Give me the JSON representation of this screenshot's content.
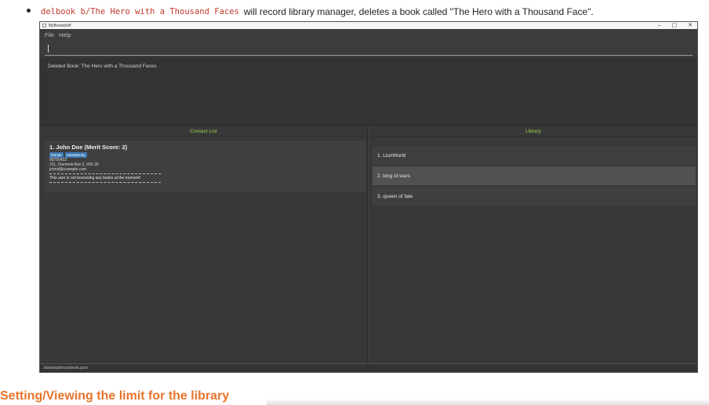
{
  "doc": {
    "command": "delbook b/The Hero with a Thousand Faces",
    "description": "will record library manager, deletes a book called \"The Hero with a Thousand Face\".",
    "section_heading": "Setting/Viewing the limit for the library"
  },
  "window": {
    "title": "MyBookshelf",
    "controls": [
      "–",
      "▢",
      "✕"
    ]
  },
  "menu": {
    "file": "File",
    "help": "Help"
  },
  "command_box": {
    "value": ""
  },
  "result": {
    "text": "Deleted Book: The Hero with a Thousand Faces"
  },
  "contact_list": {
    "title": "Contact List",
    "persons": [
      {
        "name": "1.  John Doe (Merit Score: 2)",
        "tags": [
          "friends",
          "owesMoney"
        ],
        "phone": "98765432",
        "address": "311, Clementi Ave 2, #02-25",
        "email": "johnd@example.com",
        "borrow_status": "This user is not borrowing any books at the moment!"
      }
    ]
  },
  "library": {
    "title": "Library",
    "books": [
      "1. LionWorld",
      "2. king of wars",
      "3. queen of fate"
    ]
  },
  "status_bar": {
    "path": ".\\data\\addressbook.json"
  },
  "colors": {
    "accent_title": "#9ad14b",
    "tag": "#3e7bb6",
    "heading": "#e8732a",
    "code": "#c0392b"
  }
}
